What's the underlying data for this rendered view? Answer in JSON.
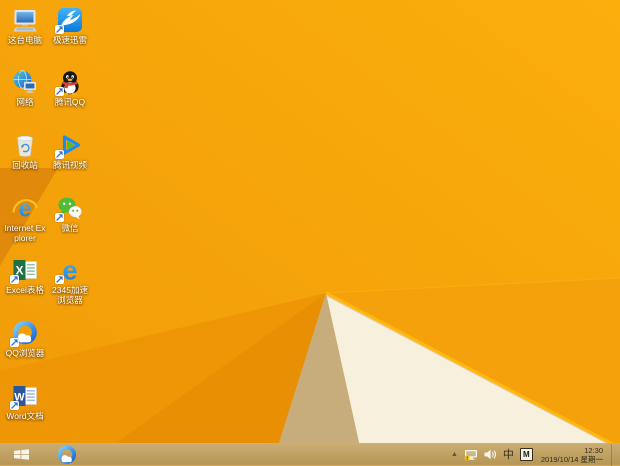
{
  "wallpaper": {
    "base_top": "#fbae0c",
    "base_bottom": "#f19b08",
    "dark_fold": "#e0890a",
    "band_a": "#ee9606",
    "band_b": "#e88f03",
    "shadow_tan": "#c7ac7c",
    "cream": "#f7f0dc",
    "right_facet": "#f4a10b",
    "ridge": "#ffb70d"
  },
  "desktop": {
    "icons": [
      {
        "id": "this-pc",
        "label": "这台电脑",
        "icon": "this-pc-icon",
        "col": 0,
        "row": 0,
        "shortcut": false
      },
      {
        "id": "thunder",
        "label": "极速迅雷",
        "icon": "thunder-bird-icon",
        "col": 1,
        "row": 0,
        "shortcut": true
      },
      {
        "id": "network",
        "label": "网络",
        "icon": "network-globe-icon",
        "col": 0,
        "row": 1,
        "shortcut": false
      },
      {
        "id": "tencent-qq",
        "label": "腾讯QQ",
        "icon": "qq-penguin-icon",
        "col": 1,
        "row": 1,
        "shortcut": true
      },
      {
        "id": "recycle-bin",
        "label": "回收站",
        "icon": "recycle-bin-icon",
        "col": 0,
        "row": 2,
        "shortcut": false
      },
      {
        "id": "tencent-video",
        "label": "腾讯视频",
        "icon": "tencent-video-play-icon",
        "col": 1,
        "row": 2,
        "shortcut": true
      },
      {
        "id": "internet-explorer",
        "label": "Internet Explorer",
        "icon": "ie-icon",
        "col": 0,
        "row": 3,
        "shortcut": false
      },
      {
        "id": "wechat",
        "label": "微信",
        "icon": "wechat-bubbles-icon",
        "col": 1,
        "row": 3,
        "shortcut": true
      },
      {
        "id": "excel",
        "label": "Excel表格",
        "icon": "excel-icon",
        "col": 0,
        "row": 4,
        "shortcut": true
      },
      {
        "id": "browser-2345",
        "label": "2345加速浏览器",
        "icon": "2345-browser-e-icon",
        "col": 1,
        "row": 4,
        "shortcut": true
      },
      {
        "id": "qq-browser",
        "label": "QQ浏览器",
        "icon": "qq-browser-icon",
        "col": 0,
        "row": 5,
        "shortcut": true
      },
      {
        "id": "word",
        "label": "Word文档",
        "icon": "word-icon",
        "col": 0,
        "row": 6,
        "shortcut": true
      }
    ]
  },
  "taskbar": {
    "pinned": [
      {
        "id": "qq-browser",
        "icon": "qq-browser-icon"
      }
    ],
    "tray": {
      "ime_mode": "中",
      "ime_badge": "M",
      "time": "12:30",
      "date": "2019/10/14 星期一"
    }
  }
}
